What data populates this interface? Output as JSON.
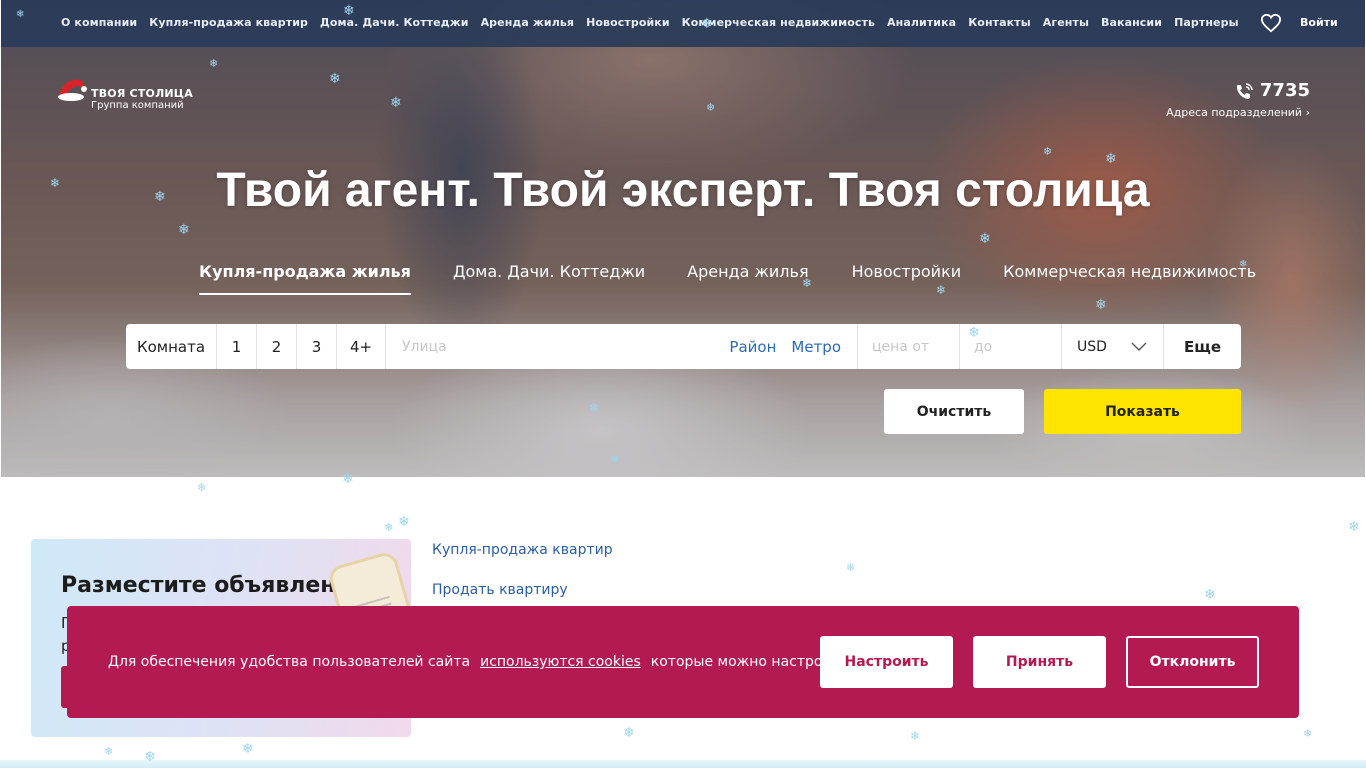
{
  "topnav": {
    "links": [
      "О компании",
      "Купля-продажа квартир",
      "Дома. Дачи. Коттеджи",
      "Аренда жилья",
      "Новостройки",
      "Коммерческая недвижимость",
      "Аналитика",
      "Контакты",
      "Агенты",
      "Вакансии",
      "Партнеры"
    ],
    "login": "Войти",
    "icons": {
      "favorites": "heart-icon"
    }
  },
  "logo": {
    "name": "ТВОЯ СТОЛИЦА",
    "subtitle": "Группа компаний"
  },
  "phone": {
    "number": "7735",
    "subtitle": "Адреса подразделений"
  },
  "hero": {
    "title": "Твой агент. Твой эксперт. Твоя столица"
  },
  "category_tabs": [
    {
      "label": "Купля-продажа жилья",
      "active": true
    },
    {
      "label": "Дома. Дачи. Коттеджи",
      "active": false
    },
    {
      "label": "Аренда жилья",
      "active": false
    },
    {
      "label": "Новостройки",
      "active": false
    },
    {
      "label": "Коммерческая недвижимость",
      "active": false
    }
  ],
  "search": {
    "room_label": "Комната",
    "rooms": [
      "1",
      "2",
      "3",
      "4+"
    ],
    "street_placeholder": "Улица",
    "district": "Район",
    "metro": "Метро",
    "price_from_placeholder": "цена от",
    "price_to_placeholder": "до",
    "currency": "USD",
    "more": "Еще"
  },
  "actions": {
    "clear": "Очистить",
    "show": "Показать"
  },
  "promo": {
    "title": "Разместите объявление",
    "line1_start": "П",
    "line2_start": "р"
  },
  "side_links": [
    "Купля-продажа квартир",
    "Продать квартиру"
  ],
  "cookie": {
    "text_before": "Для обеспечения удобства пользователей сайта",
    "link": "используются cookies",
    "text_after": "которые можно настроить",
    "configure": "Настроить",
    "accept": "Принять",
    "decline": "Отклонить"
  },
  "colors": {
    "nav_bg": "#2a3b58",
    "accent_yellow": "#ffe400",
    "cookie_bg": "#b31a52",
    "link_blue": "#2b6cb0"
  }
}
